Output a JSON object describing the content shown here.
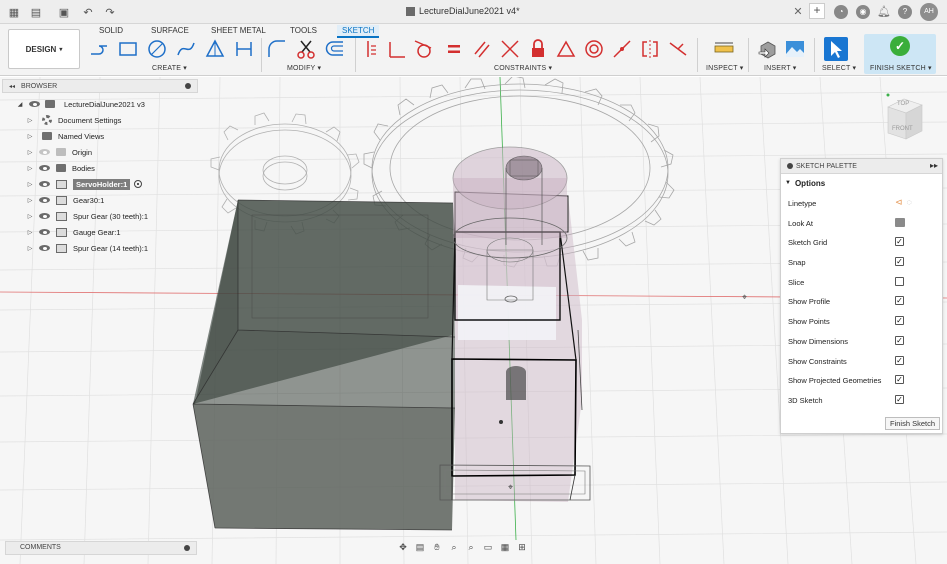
{
  "title_bar": {
    "document_title": "LectureDialJune2021 v4*",
    "avatar_initials": "AH"
  },
  "ribbon": {
    "workspace_button": "DESIGN",
    "tabs": [
      {
        "label": "SOLID"
      },
      {
        "label": "SURFACE"
      },
      {
        "label": "SHEET METAL"
      },
      {
        "label": "TOOLS"
      },
      {
        "label": "SKETCH",
        "active": true
      }
    ],
    "groups": {
      "create": "CREATE",
      "modify": "MODIFY",
      "constraints": "CONSTRAINTS",
      "inspect": "INSPECT",
      "insert": "INSERT",
      "select": "SELECT",
      "finish": "FINISH SKETCH"
    }
  },
  "browser": {
    "title": "BROWSER",
    "root": "LectureDialJune2021 v3",
    "items": [
      {
        "label": "Document Settings",
        "icon": "gear-icon"
      },
      {
        "label": "Named Views",
        "icon": "folder-icon"
      },
      {
        "label": "Origin",
        "icon": "folder-icon",
        "dim": true
      },
      {
        "label": "Bodies",
        "icon": "folder-icon"
      },
      {
        "label": "ServoHolder:1",
        "icon": "component-icon",
        "active": true
      },
      {
        "label": "Gear30:1",
        "icon": "component-icon"
      },
      {
        "label": "Spur Gear (30 teeth):1",
        "icon": "component-icon"
      },
      {
        "label": "Gauge Gear:1",
        "icon": "component-icon"
      },
      {
        "label": "Spur Gear (14 teeth):1",
        "icon": "component-icon"
      }
    ]
  },
  "view_cube": {
    "top_label": "TOP",
    "front_label": "FRONT"
  },
  "sketch_palette": {
    "title": "SKETCH PALETTE",
    "section": "Options",
    "options": [
      {
        "label": "Linetype",
        "type": "linetype"
      },
      {
        "label": "Look At",
        "type": "button"
      },
      {
        "label": "Sketch Grid",
        "checked": true
      },
      {
        "label": "Snap",
        "checked": true
      },
      {
        "label": "Slice",
        "checked": false
      },
      {
        "label": "Show Profile",
        "checked": true
      },
      {
        "label": "Show Points",
        "checked": true
      },
      {
        "label": "Show Dimensions",
        "checked": true
      },
      {
        "label": "Show Constraints",
        "checked": true
      },
      {
        "label": "Show Projected Geometries",
        "checked": true
      },
      {
        "label": "3D Sketch",
        "checked": true
      }
    ],
    "finish_button": "Finish Sketch"
  },
  "comments": {
    "title": "COMMENTS"
  },
  "colors": {
    "accent": "#0a74c4",
    "finish_green": "#3aae3a",
    "select_blue": "#1976d2",
    "constraint_red": "#d32f2f",
    "axis_red": "#e07070",
    "axis_green": "#3cb04a",
    "body_gray": "#6b6f6b"
  }
}
